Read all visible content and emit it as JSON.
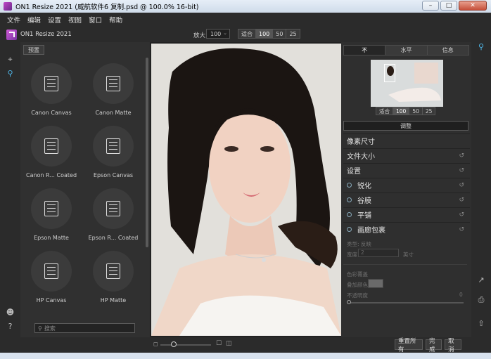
{
  "window": {
    "title": "ON1 Resize 2021 (威航软件6 复制.psd @ 100.0% 16-bit)",
    "minimize": "–",
    "maximize": "□",
    "close": "✕"
  },
  "menu": [
    "文件",
    "编辑",
    "设置",
    "视图",
    "窗口",
    "帮助"
  ],
  "toolbar": {
    "app_name": "ON1 Resize 2021",
    "zoom_label": "放大",
    "zoom_value": "100",
    "fit_label": "适合",
    "zoom_options": [
      "100",
      "50",
      "25"
    ]
  },
  "presets": {
    "tab_label": "预置",
    "items": [
      {
        "name": "Canon Canvas"
      },
      {
        "name": "Canon Matte"
      },
      {
        "name": "Canon R... Coated"
      },
      {
        "name": "Epson Canvas"
      },
      {
        "name": "Epson Matte"
      },
      {
        "name": "Epson R... Coated"
      },
      {
        "name": "HP Canvas"
      },
      {
        "name": "HP Matte"
      }
    ],
    "search_placeholder": "搜索"
  },
  "right_panel": {
    "tabs": [
      "不",
      "水平",
      "信息"
    ],
    "nav_fit": "适合",
    "nav_options": [
      "100",
      "50",
      "25"
    ],
    "adjust_button": "调整",
    "sections": [
      {
        "label": "像素尺寸",
        "radio": false,
        "reset": false
      },
      {
        "label": "文件大小",
        "radio": false,
        "reset": true
      },
      {
        "label": "设置",
        "radio": false,
        "reset": true
      },
      {
        "label": "锐化",
        "radio": true,
        "reset": true
      },
      {
        "label": "谷膜",
        "radio": true,
        "reset": true
      },
      {
        "label": "平铺",
        "radio": true,
        "reset": true
      },
      {
        "label": "画廊包裹",
        "radio": true,
        "reset": true
      }
    ],
    "gallery": {
      "type_label": "类型: 反映",
      "width_label": "宽度",
      "width_value": "2",
      "unit": "英寸",
      "color_fill_label": "色彩覆盖",
      "overlay_color_label": "叠加颜色",
      "opacity_label": "不透明度",
      "opacity_value": "0"
    }
  },
  "bottom": {
    "reset_all": "重置所有",
    "done": "完成",
    "cancel": "取消"
  }
}
